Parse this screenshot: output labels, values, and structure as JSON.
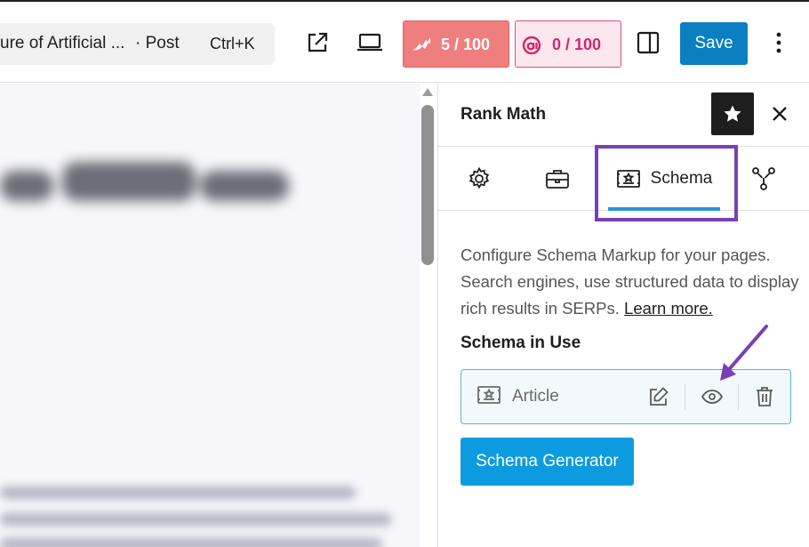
{
  "topbar": {
    "command_title": "ure of Artificial ...",
    "command_post": "· Post",
    "command_shortcut": "Ctrl+K",
    "seo_score": "5 / 100",
    "ai_score": "0 / 100",
    "save_label": "Save",
    "icons": [
      "external-link-icon",
      "desktop-preview-icon",
      "rank-math-seo-icon",
      "content-ai-icon",
      "sidebar-toggle-icon",
      "more-options-icon"
    ]
  },
  "sidebar": {
    "title": "Rank Math",
    "tabs": [
      {
        "icon": "gear-icon",
        "label": ""
      },
      {
        "icon": "briefcase-icon",
        "label": ""
      },
      {
        "icon": "schema-icon",
        "label": "Schema",
        "active": true
      },
      {
        "icon": "social-share-icon",
        "label": ""
      }
    ],
    "description_text": "Configure Schema Markup for your pages. Search engines, use structured data to display rich results in SERPs.",
    "learn_more": "Learn more.",
    "schema_in_use_heading": "Schema in Use",
    "schema_item": {
      "name": "Article"
    },
    "generator_label": "Schema Generator"
  },
  "colors": {
    "accent": "#0d9be0",
    "save": "#0a7fc2",
    "seo_score_bg": "#ef7f7f",
    "ai_score_border": "#e44a86",
    "highlight": "#7a3fb5"
  }
}
